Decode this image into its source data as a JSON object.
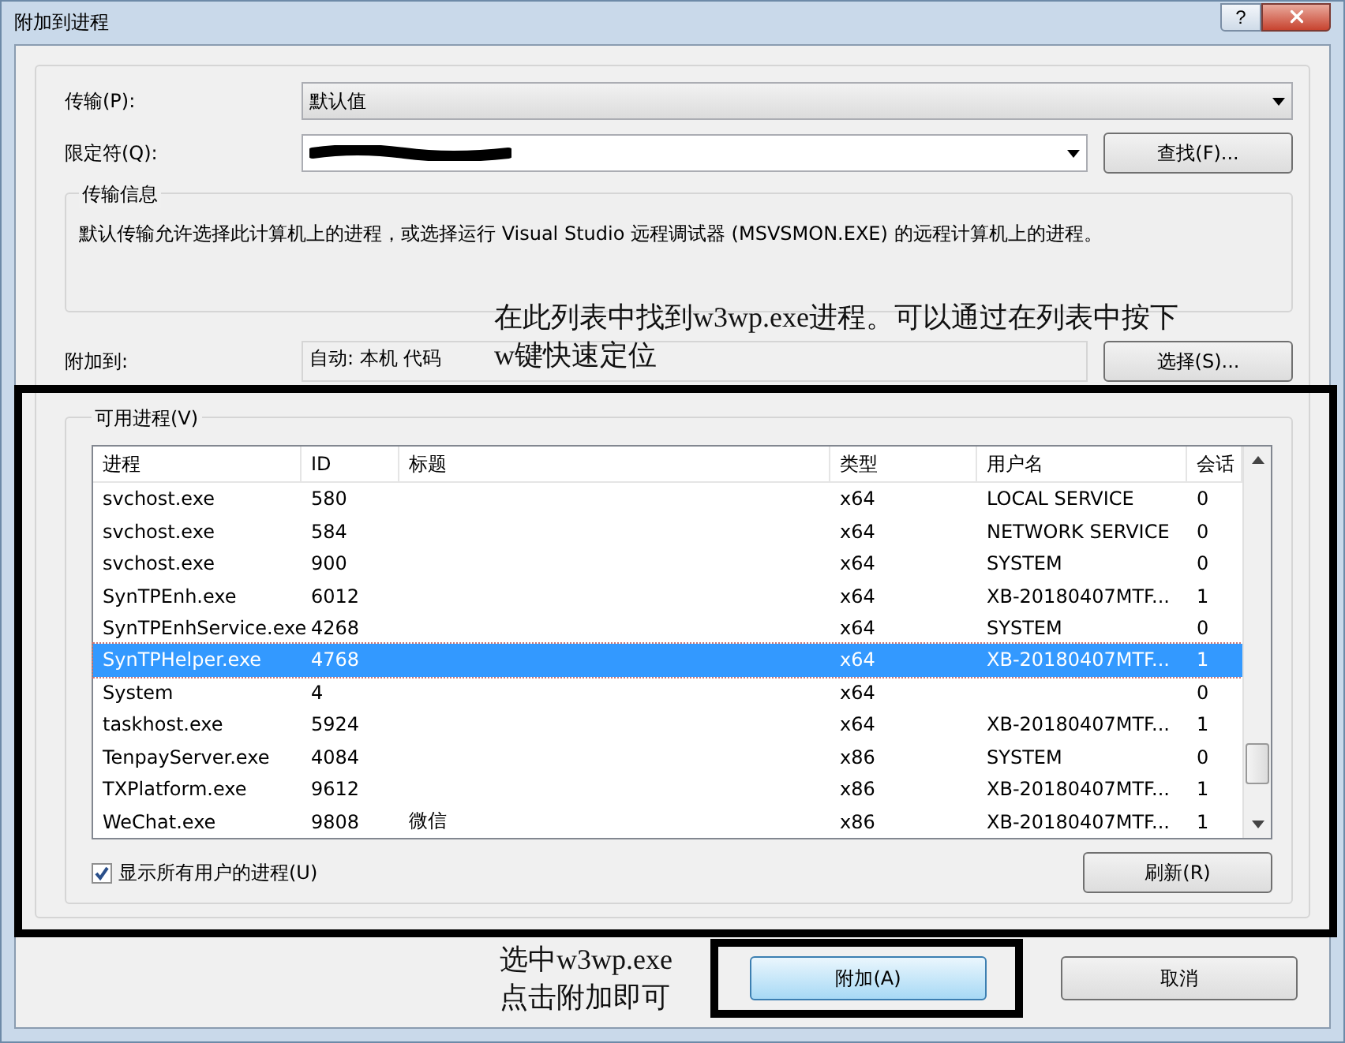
{
  "window": {
    "title": "附加到进程",
    "help_button": "?"
  },
  "transport": {
    "label": "传输(P):",
    "value": "默认值"
  },
  "qualifier": {
    "label": "限定符(Q):",
    "find_button": "查找(F)..."
  },
  "transport_info": {
    "title": "传输信息",
    "text": "默认传输允许选择此计算机上的进程，或选择运行 Visual Studio 远程调试器 (MSVSMON.EXE) 的远程计算机上的进程。"
  },
  "attach_to": {
    "label": "附加到:",
    "value": "自动: 本机 代码",
    "select_button": "选择(S)..."
  },
  "available_processes": {
    "title": "可用进程(V)",
    "columns": [
      "进程",
      "ID",
      "标题",
      "类型",
      "用户名",
      "会话"
    ],
    "rows": [
      {
        "cells": [
          "svchost.exe",
          "580",
          "",
          "x64",
          "LOCAL SERVICE",
          "0"
        ],
        "selected": false
      },
      {
        "cells": [
          "svchost.exe",
          "584",
          "",
          "x64",
          "NETWORK SERVICE",
          "0"
        ],
        "selected": false
      },
      {
        "cells": [
          "svchost.exe",
          "900",
          "",
          "x64",
          "SYSTEM",
          "0"
        ],
        "selected": false
      },
      {
        "cells": [
          "SynTPEnh.exe",
          "6012",
          "",
          "x64",
          "XB-20180407MTF...",
          "1"
        ],
        "selected": false
      },
      {
        "cells": [
          "SynTPEnhService.exe",
          "4268",
          "",
          "x64",
          "SYSTEM",
          "0"
        ],
        "selected": false
      },
      {
        "cells": [
          "SynTPHelper.exe",
          "4768",
          "",
          "x64",
          "XB-20180407MTF...",
          "1"
        ],
        "selected": true
      },
      {
        "cells": [
          "System",
          "4",
          "",
          "x64",
          "",
          "0"
        ],
        "selected": false
      },
      {
        "cells": [
          "taskhost.exe",
          "5924",
          "",
          "x64",
          "XB-20180407MTF...",
          "1"
        ],
        "selected": false
      },
      {
        "cells": [
          "TenpayServer.exe",
          "4084",
          "",
          "x86",
          "SYSTEM",
          "0"
        ],
        "selected": false
      },
      {
        "cells": [
          "TXPlatform.exe",
          "9612",
          "",
          "x86",
          "XB-20180407MTF...",
          "1"
        ],
        "selected": false
      },
      {
        "cells": [
          "WeChat.exe",
          "9808",
          "微信",
          "x86",
          "XB-20180407MTF...",
          "1"
        ],
        "selected": false
      }
    ],
    "show_all_users": {
      "label": "显示所有用户的进程(U)",
      "checked": true
    },
    "refresh_button": "刷新(R)"
  },
  "buttons": {
    "attach": "附加(A)",
    "cancel": "取消"
  },
  "annotations": [
    {
      "lines": [
        "在此列表中找到w3wp.exe进程。可以通过在列表中按下",
        "w键快速定位"
      ]
    },
    {
      "lines": [
        "选中w3wp.exe",
        "点击附加即可"
      ]
    }
  ]
}
